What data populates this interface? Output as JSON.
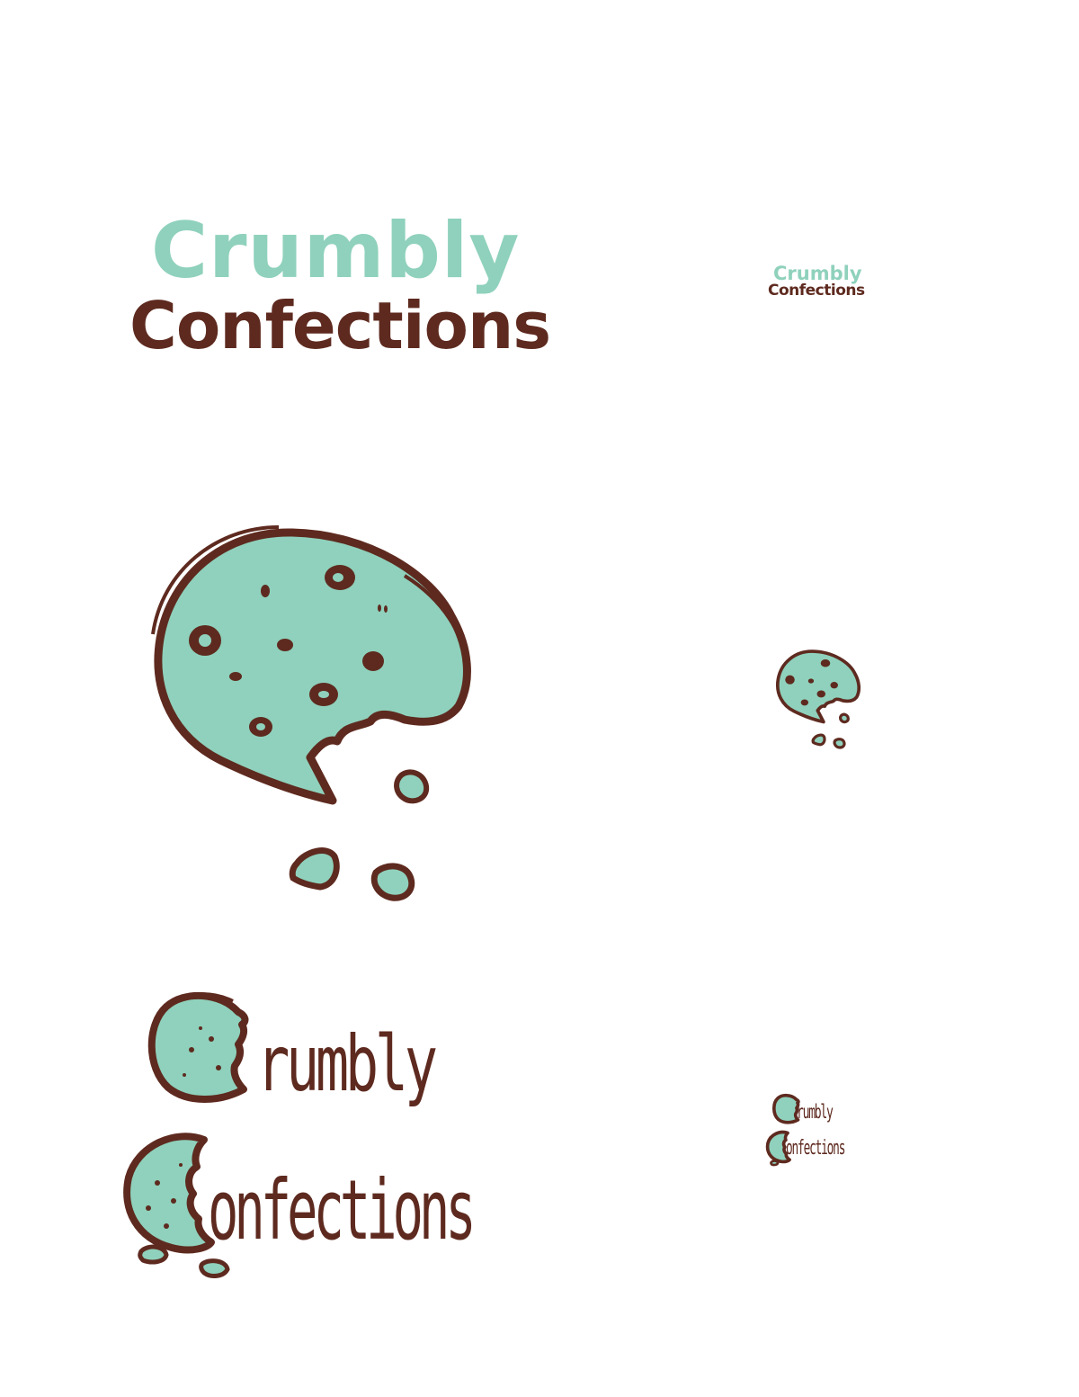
{
  "brand": {
    "line1": "Crumbly",
    "line2": "Confections",
    "line1_alt": "rumbly",
    "line2_alt": "onfections",
    "colors": {
      "mint": "#8fd1bc",
      "brown": "#5e2a1f",
      "background": "#ffffff"
    }
  },
  "icons": {
    "cookie": "bitten-cookie-icon",
    "cookie_letter_c": "cookie-letter-c-icon",
    "crumbs": "crumbs-icon"
  }
}
